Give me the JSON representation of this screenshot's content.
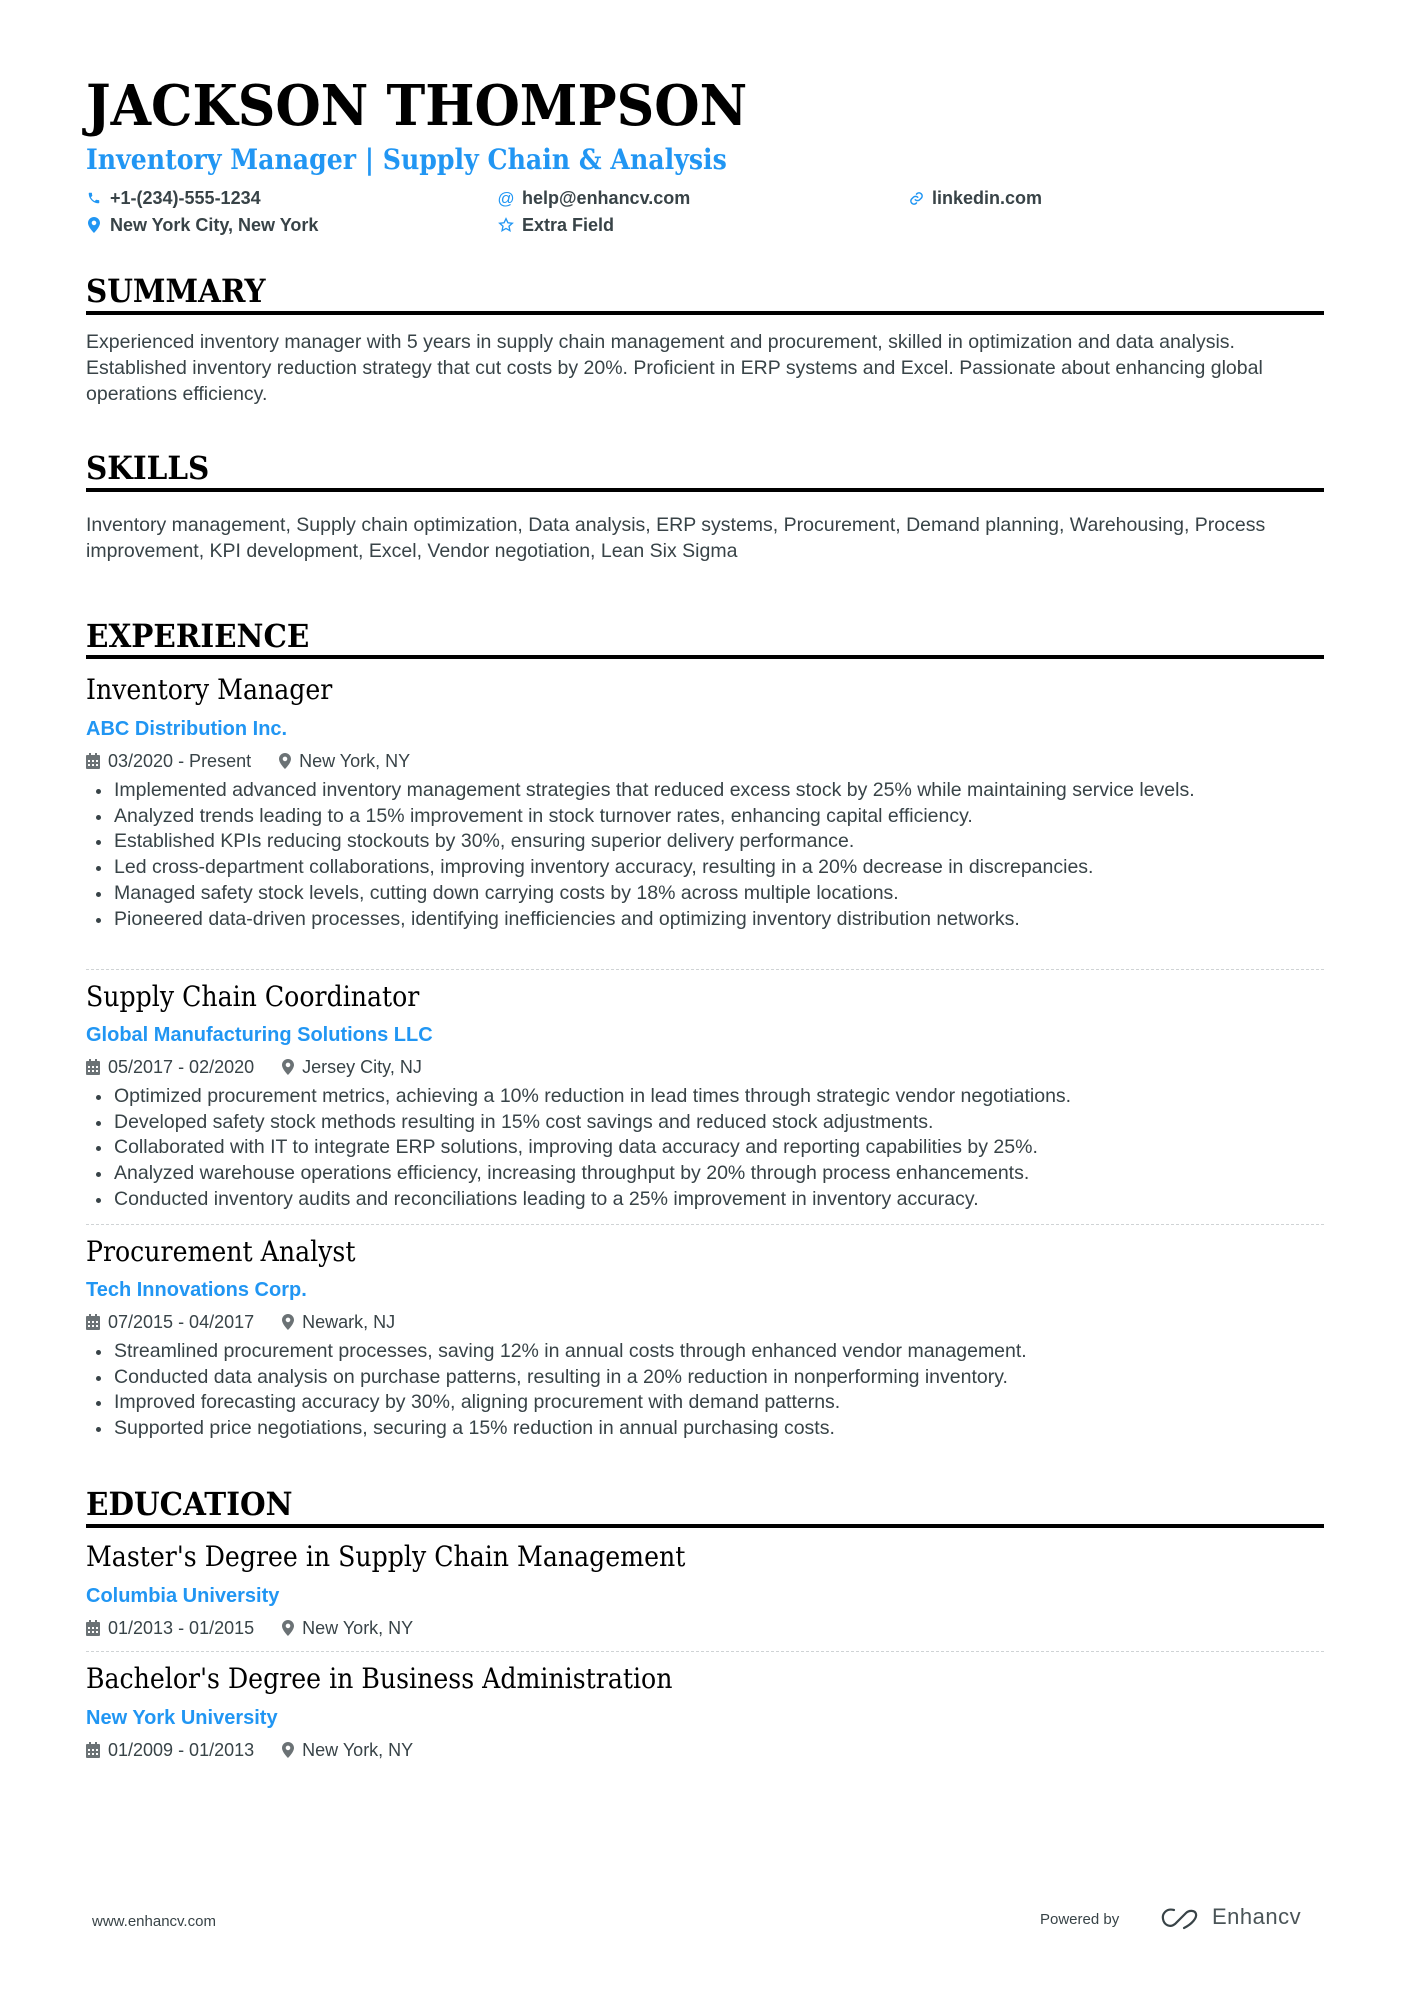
{
  "header": {
    "name": "JACKSON THOMPSON",
    "title": "Inventory Manager | Supply Chain & Analysis",
    "contacts": {
      "phone": {
        "icon": "phone-icon",
        "text": "+1-(234)-555-1234"
      },
      "email": {
        "icon": "at-icon",
        "text": "help@enhancv.com"
      },
      "linkedin": {
        "icon": "link-icon",
        "text": "linkedin.com"
      },
      "location": {
        "icon": "map-pin-icon",
        "text": "New York City, New York"
      },
      "extra": {
        "icon": "star-icon",
        "text": "Extra Field"
      }
    }
  },
  "summary": {
    "heading": "SUMMARY",
    "text": "Experienced inventory manager with 5 years in supply chain management and procurement, skilled in optimization and data analysis. Established inventory reduction strategy that cut costs by 20%. Proficient in ERP systems and Excel. Passionate about enhancing global operations efficiency."
  },
  "skills": {
    "heading": "SKILLS",
    "text": "Inventory management, Supply chain optimization, Data analysis, ERP systems, Procurement, Demand planning, Warehousing, Process improvement, KPI development, Excel, Vendor negotiation, Lean Six Sigma"
  },
  "experience": {
    "heading": "EXPERIENCE",
    "jobs": [
      {
        "title": "Inventory Manager",
        "company": "ABC Distribution Inc.",
        "dates": "03/2020 - Present",
        "location": "New York, NY",
        "bullets": [
          "Implemented advanced inventory management strategies that reduced excess stock by 25% while maintaining service levels.",
          "Analyzed trends leading to a 15% improvement in stock turnover rates, enhancing capital efficiency.",
          "Established KPIs reducing stockouts by 30%, ensuring superior delivery performance.",
          "Led cross-department collaborations, improving inventory accuracy, resulting in a 20% decrease in discrepancies.",
          "Managed safety stock levels, cutting down carrying costs by 18% across multiple locations.",
          "Pioneered data-driven processes, identifying inefficiencies and optimizing inventory distribution networks."
        ]
      },
      {
        "title": "Supply Chain Coordinator",
        "company": "Global Manufacturing Solutions LLC",
        "dates": "05/2017 - 02/2020",
        "location": "Jersey City, NJ",
        "bullets": [
          "Optimized procurement metrics, achieving a 10% reduction in lead times through strategic vendor negotiations.",
          "Developed safety stock methods resulting in 15% cost savings and reduced stock adjustments.",
          "Collaborated with IT to integrate ERP solutions, improving data accuracy and reporting capabilities by 25%.",
          "Analyzed warehouse operations efficiency, increasing throughput by 20% through process enhancements.",
          "Conducted inventory audits and reconciliations leading to a 25% improvement in inventory accuracy."
        ]
      },
      {
        "title": "Procurement Analyst",
        "company": "Tech Innovations Corp.",
        "dates": "07/2015 - 04/2017",
        "location": "Newark, NJ",
        "bullets": [
          "Streamlined procurement processes, saving 12% in annual costs through enhanced vendor management.",
          "Conducted data analysis on purchase patterns, resulting in a 20% reduction in nonperforming inventory.",
          "Improved forecasting accuracy by 30%, aligning procurement with demand patterns.",
          "Supported price negotiations, securing a 15% reduction in annual purchasing costs."
        ]
      }
    ]
  },
  "education": {
    "heading": "EDUCATION",
    "items": [
      {
        "degree": "Master's Degree in Supply Chain Management",
        "school": "Columbia University",
        "dates": "01/2013 - 01/2015",
        "location": "New York, NY"
      },
      {
        "degree": "Bachelor's Degree in Business Administration",
        "school": "New York University",
        "dates": "01/2009 - 01/2013",
        "location": "New York, NY"
      }
    ]
  },
  "footer": {
    "url": "www.enhancv.com",
    "powered_by": "Powered by",
    "brand": "Enhancv"
  },
  "colors": {
    "accent": "#2196f3",
    "text": "#384347",
    "heading": "#000000"
  }
}
